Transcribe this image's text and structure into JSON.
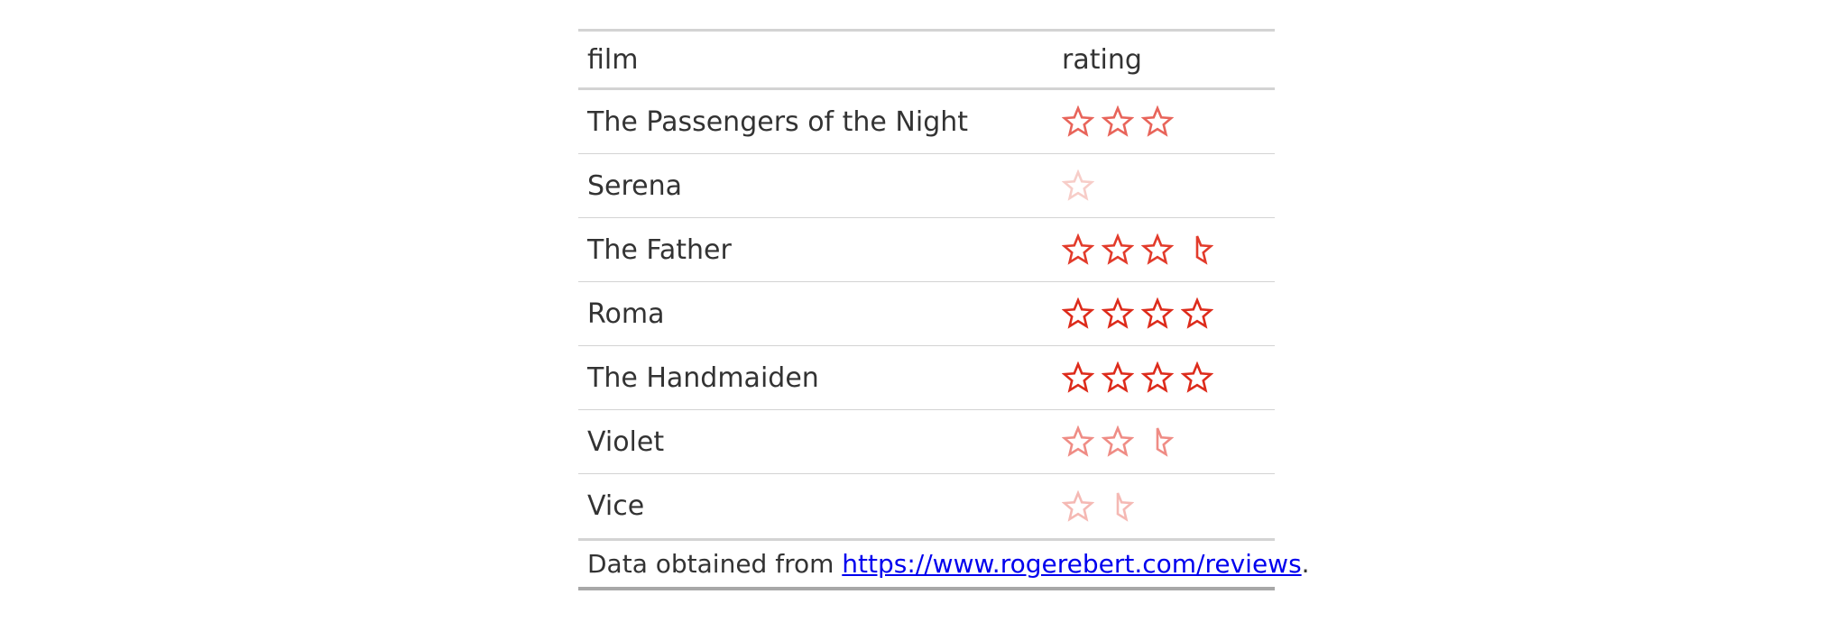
{
  "table": {
    "headers": {
      "film": "film",
      "rating": "rating"
    },
    "rows": [
      {
        "film": "The Passengers of the Night",
        "rating": 3,
        "color": "#e8645a"
      },
      {
        "film": "Serena",
        "rating": 1,
        "color": "#f7cdc8"
      },
      {
        "film": "The Father",
        "rating": 3.5,
        "color": "#e23b2b"
      },
      {
        "film": "Roma",
        "rating": 4,
        "color": "#dd2b1b"
      },
      {
        "film": "The Handmaiden",
        "rating": 4,
        "color": "#dd2b1b"
      },
      {
        "film": "Violet",
        "rating": 2.5,
        "color": "#ef8c85"
      },
      {
        "film": "Vice",
        "rating": 1.5,
        "color": "#f5b9b4"
      }
    ]
  },
  "footer": {
    "prefix": "Data obtained from ",
    "link_text": "https://www.rogerebert.com/reviews",
    "suffix": "."
  }
}
